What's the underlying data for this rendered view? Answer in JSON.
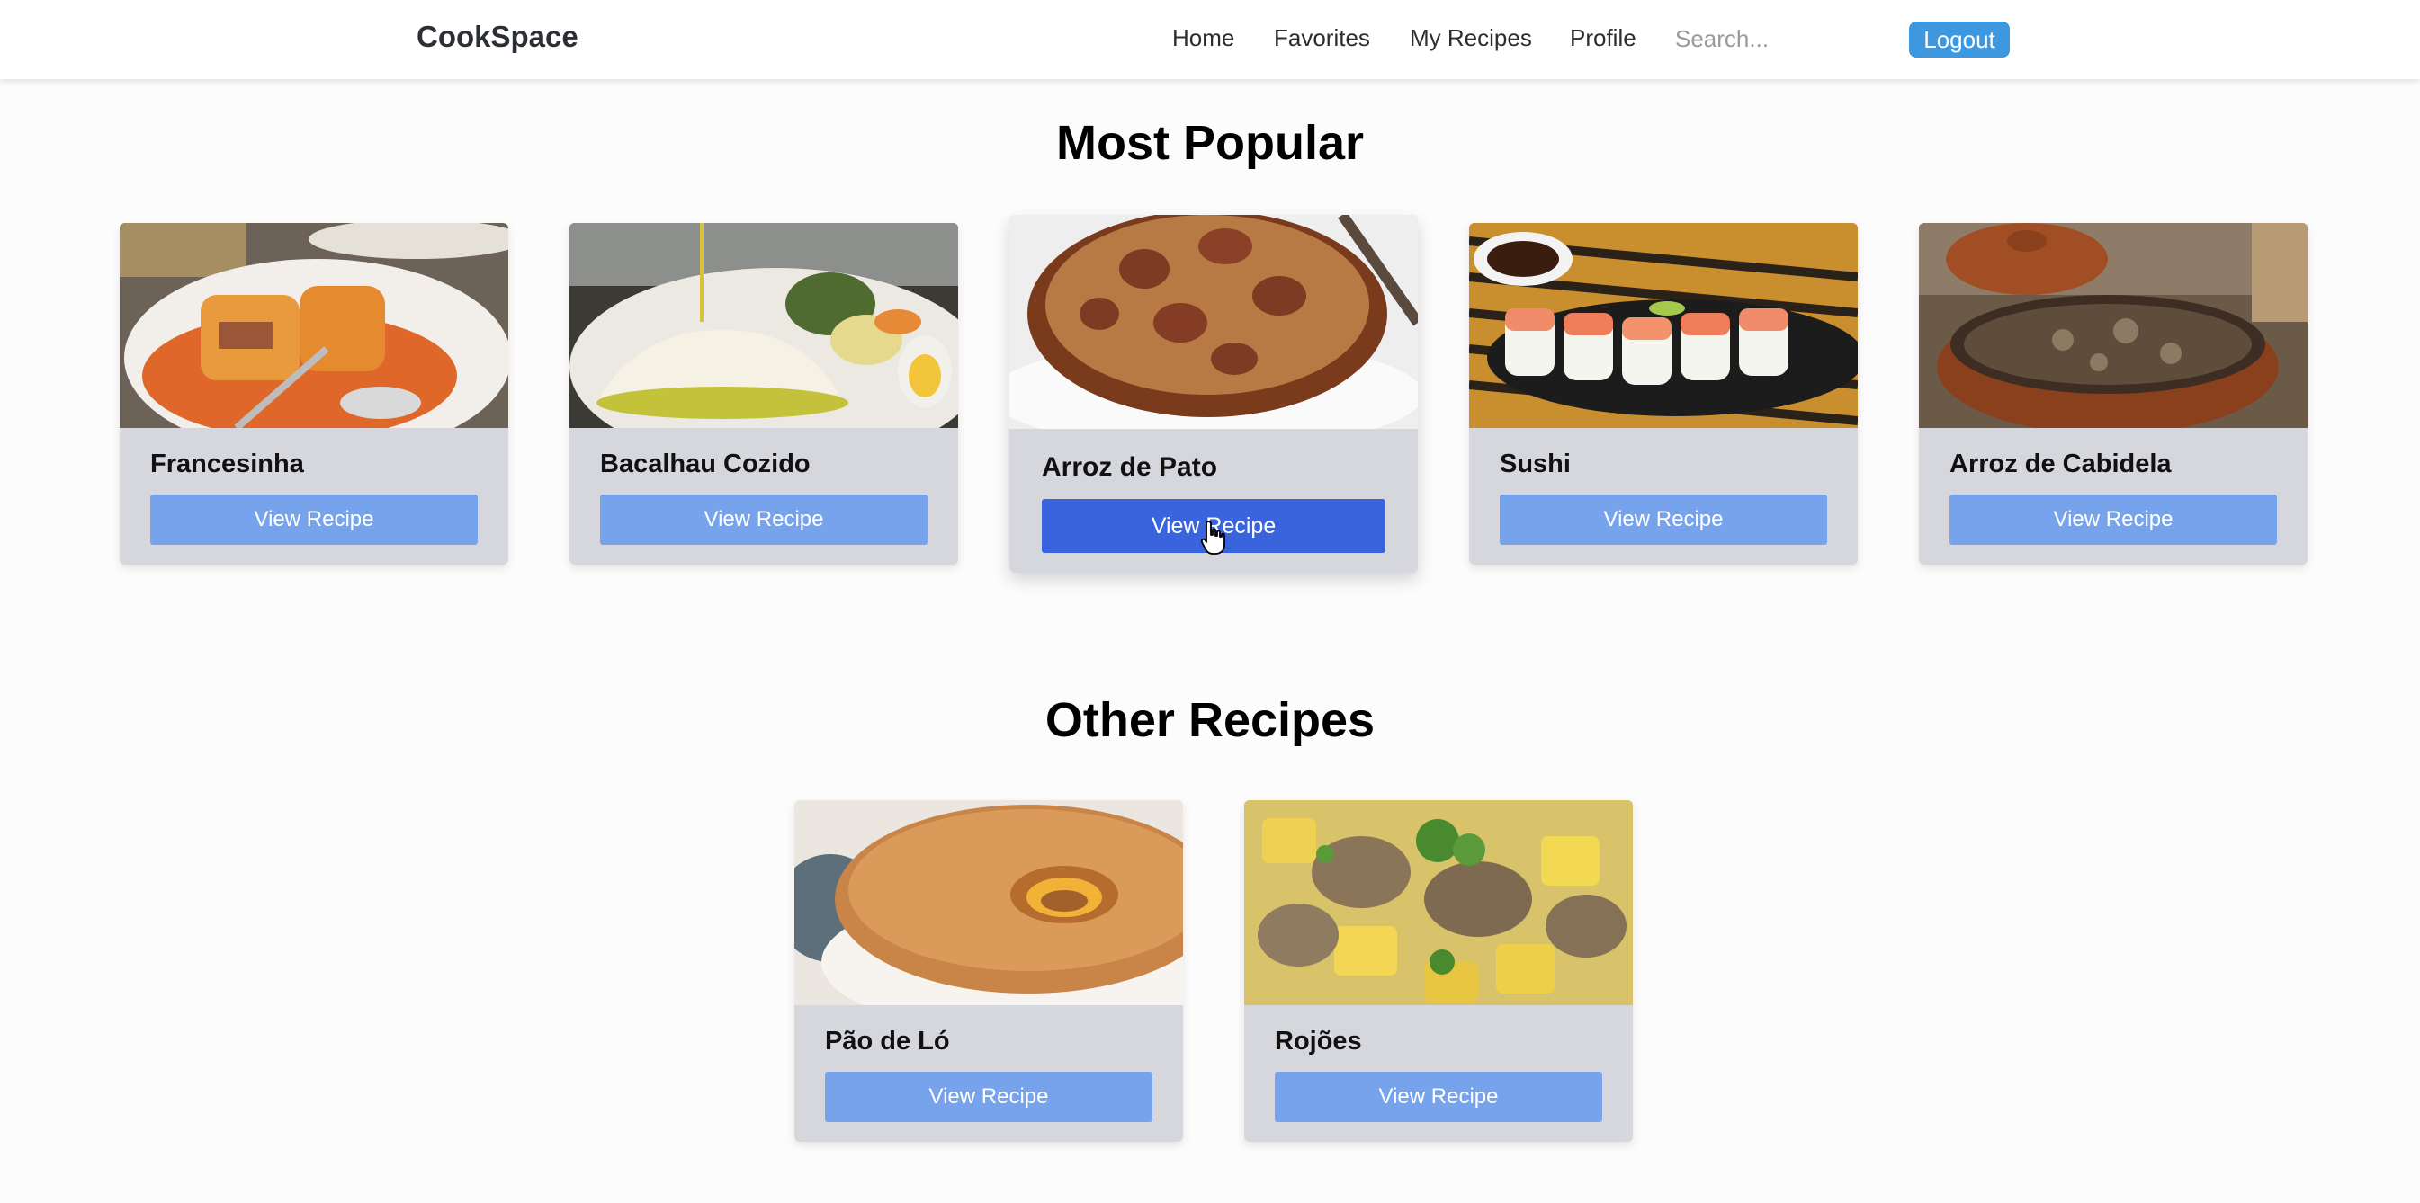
{
  "navbar": {
    "brand": "CookSpace",
    "links": [
      "Home",
      "Favorites",
      "My Recipes",
      "Profile"
    ],
    "search_placeholder": "Search...",
    "logout_label": "Logout"
  },
  "most_popular": {
    "title": "Most Popular",
    "cards": [
      {
        "name": "Francesinha",
        "button": "View Recipe",
        "image": "francesinha-photo"
      },
      {
        "name": "Bacalhau Cozido",
        "button": "View Recipe",
        "image": "bacalhau-cozido-photo"
      },
      {
        "name": "Arroz de Pato",
        "button": "View Recipe",
        "image": "arroz-de-pato-photo"
      },
      {
        "name": "Sushi",
        "button": "View Recipe",
        "image": "sushi-photo"
      },
      {
        "name": "Arroz de Cabidela",
        "button": "View Recipe",
        "image": "arroz-de-cabidela-photo"
      }
    ]
  },
  "other_recipes": {
    "title": "Other Recipes",
    "cards": [
      {
        "name": "Pão de Ló",
        "button": "View Recipe",
        "image": "pao-de-lo-photo"
      },
      {
        "name": "Rojões",
        "button": "View Recipe",
        "image": "rojoes-photo"
      }
    ]
  },
  "hovered_card": "Arroz de Pato",
  "colors": {
    "brand_text": "#2c2f33",
    "logout_button": "#3d98e0",
    "view_button": "#76a3ec",
    "view_button_hover": "#3a64de",
    "card_background": "#d5d7dc",
    "page_background": "#fdfcfc"
  }
}
